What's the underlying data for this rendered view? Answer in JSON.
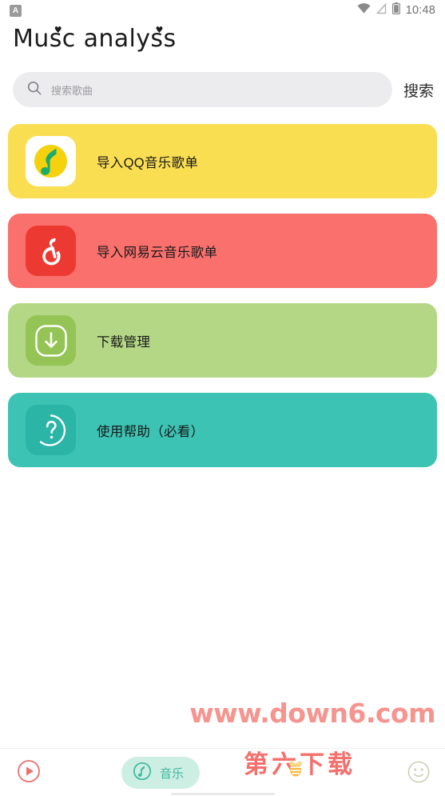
{
  "status_bar": {
    "app_badge": "A",
    "time": "10:48",
    "icons": [
      "wifi-icon",
      "signal-off-icon",
      "battery-icon"
    ]
  },
  "header": {
    "title_part1": "Mus",
    "title_part2": "c analys",
    "title_part3": "s",
    "title_full": "Music analysis"
  },
  "search": {
    "placeholder": "搜索歌曲",
    "value": "",
    "button_label": "搜索",
    "icon": "search-icon"
  },
  "cards": [
    {
      "id": "import-qq-playlist",
      "label": "导入QQ音乐歌单",
      "bg": "#fade52",
      "icon_bg": "#ffffff",
      "icon": "qq-music-icon"
    },
    {
      "id": "import-netease-playlist",
      "label": "导入网易云音乐歌单",
      "bg": "#f9706c",
      "icon_bg": "#ec3a33",
      "icon": "netease-music-icon"
    },
    {
      "id": "download-manager",
      "label": "下载管理",
      "bg": "#b4d785",
      "icon_bg": "#93c455",
      "icon": "download-icon"
    },
    {
      "id": "usage-help",
      "label": "使用帮助（必看）",
      "bg": "#3dc3b3",
      "icon_bg": "#2ab5a6",
      "icon": "question-mark-icon"
    }
  ],
  "watermarks": {
    "site_url": "www.down6.com",
    "site_url_color": "#f6948f",
    "site_name": "第六下载",
    "site_name_color": "#f4706c"
  },
  "bottom_nav": {
    "play_icon": "play-circle-icon",
    "music_tab_label": "音乐",
    "music_tab_icon": "music-disc-icon",
    "music_tab_bg": "#cdeee3",
    "music_tab_color": "#3bb79f",
    "smiley_icon": "smiley-face-icon"
  }
}
